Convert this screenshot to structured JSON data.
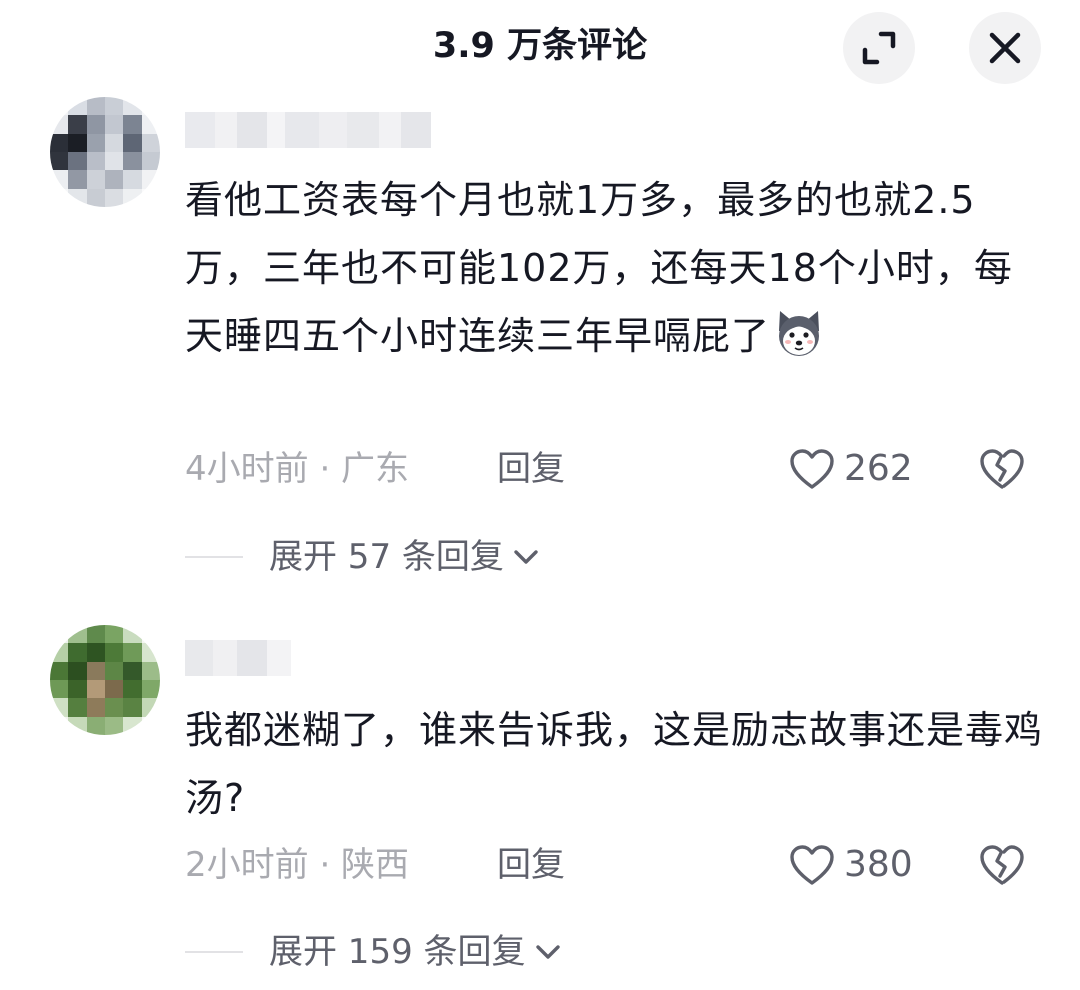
{
  "header": {
    "title": "3.9 万条评论",
    "expand_icon": "expand-corners-icon",
    "close_icon": "close-icon"
  },
  "comments": [
    {
      "text": "看他工资表每个月也就1万多，最多的也就2.5万，三年也不可能102万，还每天18个小时，每天睡四五个小时连续三年早嗝屁了",
      "emoji": "husky-dog-emoji",
      "meta": "4小时前 · 广东",
      "reply_label": "回复",
      "likes": "262",
      "expand_label": "展开 57 条回复"
    },
    {
      "text": "我都迷糊了，谁来告诉我，这是励志故事还是毒鸡汤?",
      "meta": "2小时前 · 陕西",
      "reply_label": "回复",
      "likes": "380",
      "expand_label": "展开 159 条回复"
    }
  ],
  "colors": {
    "text_primary": "#161823",
    "text_meta": "#a9aab0",
    "text_secondary": "#5e606b",
    "button_bg": "#f2f2f3"
  }
}
